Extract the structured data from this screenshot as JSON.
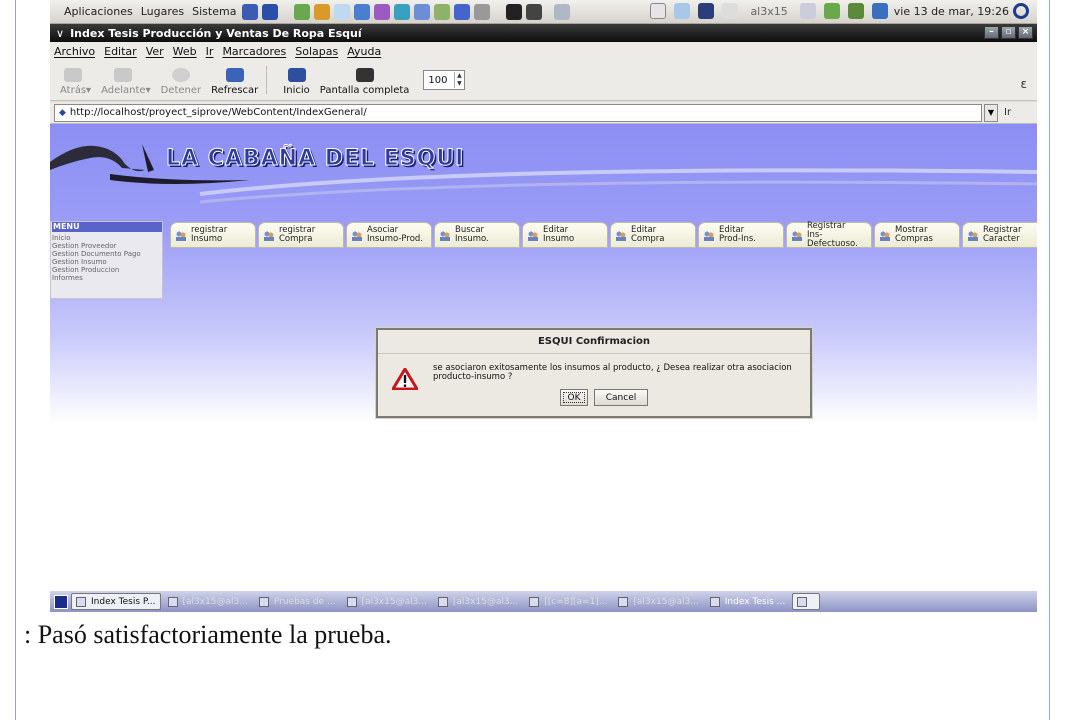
{
  "top_panel": {
    "menus": [
      "Aplicaciones",
      "Lugares",
      "Sistema"
    ],
    "user": "al3x15",
    "clock": "vie 13 de mar, 19:26"
  },
  "window": {
    "title": "Index Tesis Producción y Ventas De Ropa Esquí"
  },
  "menubar": [
    "Archivo",
    "Editar",
    "Ver",
    "Web",
    "Ir",
    "Marcadores",
    "Solapas",
    "Ayuda"
  ],
  "toolbar": {
    "back": "Atrás",
    "forward": "Adelante",
    "stop": "Detener",
    "reload": "Refrescar",
    "home": "Inicio",
    "fullscreen": "Pantalla completa",
    "zoom": "100"
  },
  "address": {
    "url": "http://localhost/proyect_siprove/WebContent/IndexGeneral/",
    "go": "Ir"
  },
  "page": {
    "logo": "LA CABAÑA DEL ESQUI",
    "menu_title": "MENU",
    "menu_items": [
      "Inicio",
      "Gestion Proveedor",
      "Gestion Documento Pago",
      "Gestion Insumo",
      "Gestion Produccion",
      "Informes"
    ],
    "tabs": [
      {
        "line1": "registrar",
        "line2": "Insumo"
      },
      {
        "line1": "registrar",
        "line2": "Compra"
      },
      {
        "line1": "Asociar",
        "line2": "Insumo-Prod."
      },
      {
        "line1": "Buscar",
        "line2": "Insumo."
      },
      {
        "line1": "Editar",
        "line2": "Insumo"
      },
      {
        "line1": "Editar",
        "line2": "Compra"
      },
      {
        "line1": "Editar",
        "line2": "Prod-Ins."
      },
      {
        "line1": "Registrar",
        "line2": "Ins-Defectuoso."
      },
      {
        "line1": "Mostrar",
        "line2": "Compras"
      },
      {
        "line1": "Registrar",
        "line2": "Caracter"
      }
    ]
  },
  "dialog": {
    "title": "ESQUI Confirmacion",
    "message": "se asociaron exitosamente los insumos al producto, ¿ Desea realizar otra asociacion producto-insumo ?",
    "ok": "OK",
    "cancel": "Cancel"
  },
  "taskbar": [
    {
      "label": "Index Tesis P...",
      "state": "normal"
    },
    {
      "label": "[al3x15@al3...",
      "state": "dim"
    },
    {
      "label": "Pruebas de ...",
      "state": "dim"
    },
    {
      "label": "[al3x15@al3...",
      "state": "dim"
    },
    {
      "label": "[al3x15@al3...",
      "state": "dim"
    },
    {
      "label": "[[c=8][a=1]...",
      "state": "dim"
    },
    {
      "label": "[al3x15@al3...",
      "state": "dim"
    },
    {
      "label": "Index Tesis ...",
      "state": "normal"
    }
  ],
  "caption": ":   Pasó satisfactoriamente la prueba."
}
